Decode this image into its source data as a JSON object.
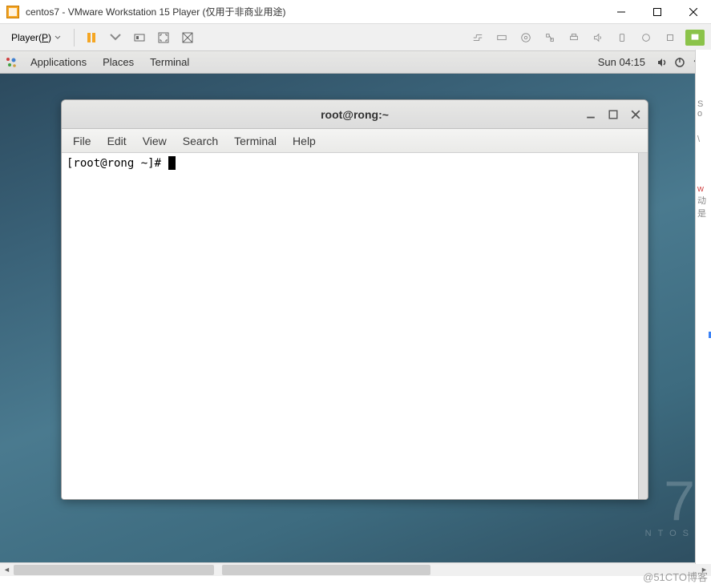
{
  "windows": {
    "title": "centos7 - VMware Workstation 15 Player (仅用于非商业用途)"
  },
  "vmtoolbar": {
    "player_label": "Player(P)"
  },
  "gnome": {
    "menus": [
      "Applications",
      "Places",
      "Terminal"
    ],
    "clock": "Sun 04:15"
  },
  "terminal": {
    "title": "root@rong:~",
    "menus": [
      "File",
      "Edit",
      "View",
      "Search",
      "Terminal",
      "Help"
    ],
    "prompt": "[root@rong ~]# "
  },
  "desktop": {
    "version": "7",
    "brand": "NTOS"
  },
  "watermark": "@51CTO博客"
}
